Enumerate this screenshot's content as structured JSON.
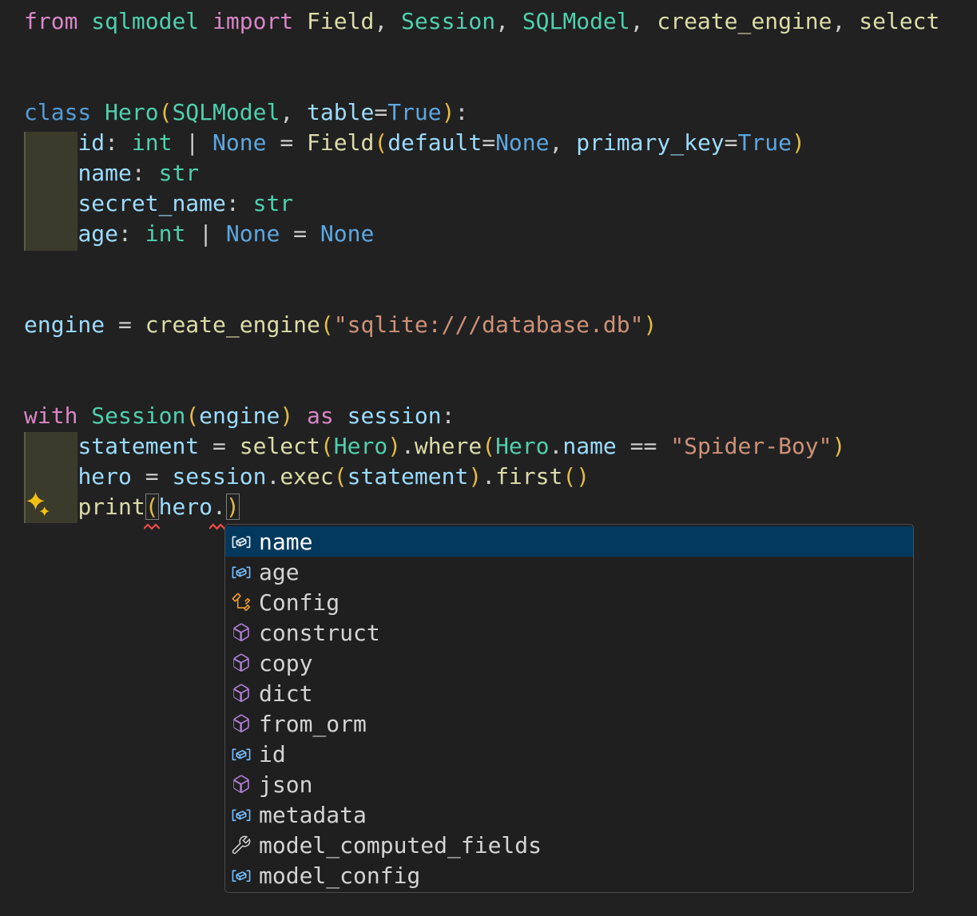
{
  "editor": {
    "background": "#212121",
    "lines": [
      {
        "tokens": [
          {
            "t": "from",
            "c": "kw"
          },
          {
            "t": " ",
            "c": "pun"
          },
          {
            "t": "sqlmodel",
            "c": "cls"
          },
          {
            "t": " ",
            "c": "pun"
          },
          {
            "t": "import",
            "c": "kw"
          },
          {
            "t": " ",
            "c": "pun"
          },
          {
            "t": "Field",
            "c": "fn"
          },
          {
            "t": ", ",
            "c": "pun"
          },
          {
            "t": "Session",
            "c": "cls"
          },
          {
            "t": ", ",
            "c": "pun"
          },
          {
            "t": "SQLModel",
            "c": "cls"
          },
          {
            "t": ", ",
            "c": "pun"
          },
          {
            "t": "create_engine",
            "c": "fn"
          },
          {
            "t": ", ",
            "c": "pun"
          },
          {
            "t": "select",
            "c": "fn"
          }
        ]
      },
      {
        "tokens": []
      },
      {
        "tokens": []
      },
      {
        "tokens": [
          {
            "t": "class",
            "c": "def"
          },
          {
            "t": " ",
            "c": "pun"
          },
          {
            "t": "Hero",
            "c": "cls"
          },
          {
            "t": "(",
            "c": "br"
          },
          {
            "t": "SQLModel",
            "c": "cls"
          },
          {
            "t": ", ",
            "c": "pun"
          },
          {
            "t": "table",
            "c": "var"
          },
          {
            "t": "=",
            "c": "pun"
          },
          {
            "t": "True",
            "c": "const"
          },
          {
            "t": ")",
            "c": "br"
          },
          {
            "t": ":",
            "c": "pun"
          }
        ]
      },
      {
        "tokens": [
          {
            "t": "    ",
            "c": "pun"
          },
          {
            "t": "id",
            "c": "var"
          },
          {
            "t": ": ",
            "c": "pun"
          },
          {
            "t": "int",
            "c": "cls"
          },
          {
            "t": " | ",
            "c": "pun"
          },
          {
            "t": "None",
            "c": "const"
          },
          {
            "t": " = ",
            "c": "pun"
          },
          {
            "t": "Field",
            "c": "fn"
          },
          {
            "t": "(",
            "c": "br"
          },
          {
            "t": "default",
            "c": "var"
          },
          {
            "t": "=",
            "c": "pun"
          },
          {
            "t": "None",
            "c": "const"
          },
          {
            "t": ", ",
            "c": "pun"
          },
          {
            "t": "primary_key",
            "c": "var"
          },
          {
            "t": "=",
            "c": "pun"
          },
          {
            "t": "True",
            "c": "const"
          },
          {
            "t": ")",
            "c": "br"
          }
        ]
      },
      {
        "tokens": [
          {
            "t": "    ",
            "c": "pun"
          },
          {
            "t": "name",
            "c": "var"
          },
          {
            "t": ": ",
            "c": "pun"
          },
          {
            "t": "str",
            "c": "cls"
          }
        ]
      },
      {
        "tokens": [
          {
            "t": "    ",
            "c": "pun"
          },
          {
            "t": "secret_name",
            "c": "var"
          },
          {
            "t": ": ",
            "c": "pun"
          },
          {
            "t": "str",
            "c": "cls"
          }
        ]
      },
      {
        "tokens": [
          {
            "t": "    ",
            "c": "pun"
          },
          {
            "t": "age",
            "c": "var"
          },
          {
            "t": ": ",
            "c": "pun"
          },
          {
            "t": "int",
            "c": "cls"
          },
          {
            "t": " | ",
            "c": "pun"
          },
          {
            "t": "None",
            "c": "const"
          },
          {
            "t": " = ",
            "c": "pun"
          },
          {
            "t": "None",
            "c": "const"
          }
        ]
      },
      {
        "tokens": []
      },
      {
        "tokens": []
      },
      {
        "tokens": [
          {
            "t": "engine",
            "c": "var"
          },
          {
            "t": " = ",
            "c": "pun"
          },
          {
            "t": "create_engine",
            "c": "fn"
          },
          {
            "t": "(",
            "c": "br"
          },
          {
            "t": "\"sqlite:///database.db\"",
            "c": "str"
          },
          {
            "t": ")",
            "c": "br"
          }
        ]
      },
      {
        "tokens": []
      },
      {
        "tokens": []
      },
      {
        "tokens": [
          {
            "t": "with",
            "c": "kw"
          },
          {
            "t": " ",
            "c": "pun"
          },
          {
            "t": "Session",
            "c": "cls"
          },
          {
            "t": "(",
            "c": "br"
          },
          {
            "t": "engine",
            "c": "var"
          },
          {
            "t": ")",
            "c": "br"
          },
          {
            "t": " ",
            "c": "pun"
          },
          {
            "t": "as",
            "c": "kw"
          },
          {
            "t": " ",
            "c": "pun"
          },
          {
            "t": "session",
            "c": "var"
          },
          {
            "t": ":",
            "c": "pun"
          }
        ]
      },
      {
        "tokens": [
          {
            "t": "    ",
            "c": "pun"
          },
          {
            "t": "statement",
            "c": "var"
          },
          {
            "t": " = ",
            "c": "pun"
          },
          {
            "t": "select",
            "c": "fn"
          },
          {
            "t": "(",
            "c": "br"
          },
          {
            "t": "Hero",
            "c": "cls"
          },
          {
            "t": ")",
            "c": "br"
          },
          {
            "t": ".",
            "c": "pun"
          },
          {
            "t": "where",
            "c": "fn"
          },
          {
            "t": "(",
            "c": "br"
          },
          {
            "t": "Hero",
            "c": "cls"
          },
          {
            "t": ".",
            "c": "pun"
          },
          {
            "t": "name",
            "c": "var"
          },
          {
            "t": " == ",
            "c": "pun"
          },
          {
            "t": "\"Spider-Boy\"",
            "c": "str"
          },
          {
            "t": ")",
            "c": "br"
          }
        ]
      },
      {
        "tokens": [
          {
            "t": "    ",
            "c": "pun"
          },
          {
            "t": "hero",
            "c": "var"
          },
          {
            "t": " = ",
            "c": "pun"
          },
          {
            "t": "session",
            "c": "var"
          },
          {
            "t": ".",
            "c": "pun"
          },
          {
            "t": "exec",
            "c": "fn"
          },
          {
            "t": "(",
            "c": "br"
          },
          {
            "t": "statement",
            "c": "var"
          },
          {
            "t": ")",
            "c": "br"
          },
          {
            "t": ".",
            "c": "pun"
          },
          {
            "t": "first",
            "c": "fn"
          },
          {
            "t": "(",
            "c": "br"
          },
          {
            "t": ")",
            "c": "br"
          }
        ]
      },
      {
        "tokens": [
          {
            "t": "    ",
            "c": "pun"
          },
          {
            "t": "print",
            "c": "fn"
          },
          {
            "t": "(",
            "c": "br",
            "boxed": true
          },
          {
            "t": "hero",
            "c": "var"
          },
          {
            "t": ".",
            "c": "pun"
          },
          {
            "t": ")",
            "c": "br",
            "boxed": true
          }
        ]
      }
    ]
  },
  "suggest": {
    "items": [
      {
        "label": "name",
        "kind": "variable",
        "selected": true
      },
      {
        "label": "age",
        "kind": "variable",
        "selected": false
      },
      {
        "label": "Config",
        "kind": "class",
        "selected": false
      },
      {
        "label": "construct",
        "kind": "method",
        "selected": false
      },
      {
        "label": "copy",
        "kind": "method",
        "selected": false
      },
      {
        "label": "dict",
        "kind": "method",
        "selected": false
      },
      {
        "label": "from_orm",
        "kind": "method",
        "selected": false
      },
      {
        "label": "id",
        "kind": "variable",
        "selected": false
      },
      {
        "label": "json",
        "kind": "method",
        "selected": false
      },
      {
        "label": "metadata",
        "kind": "variable",
        "selected": false
      },
      {
        "label": "model_computed_fields",
        "kind": "property",
        "selected": false
      },
      {
        "label": "model_config",
        "kind": "variable",
        "selected": false
      }
    ]
  },
  "colors": {
    "selection_bg": "#04395e",
    "icon_variable": "#75beff",
    "icon_method": "#b180d7",
    "icon_class": "#ee9d28",
    "icon_property": "#d4d4d4",
    "error_squiggle": "#f14c4c",
    "sparkle": "#f2c012",
    "bracket_gold": "#e3bc45",
    "keyword_pink": "#d886c6",
    "type_teal": "#4fd0ae",
    "function_yellow": "#dcdcaa",
    "variable_blue": "#9cdcfe",
    "string_salmon": "#ce9178"
  }
}
